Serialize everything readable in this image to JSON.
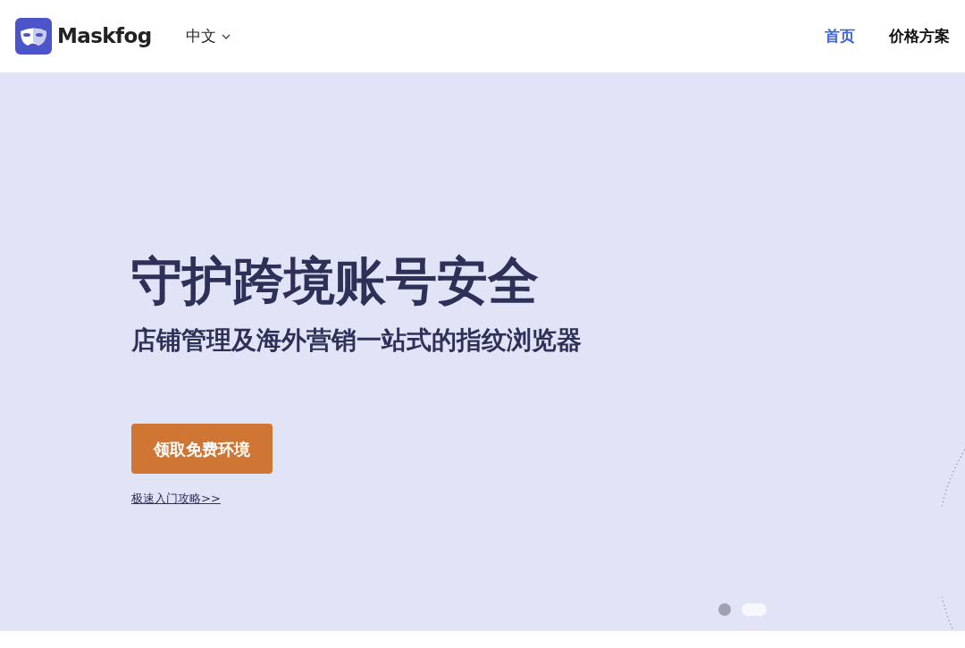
{
  "header": {
    "brand": "Maskfog",
    "language": "中文",
    "nav": [
      {
        "label": "首页",
        "selected": true
      },
      {
        "label": "价格方案",
        "selected": false
      }
    ]
  },
  "hero": {
    "title": "守护跨境账号安全",
    "subtitle": "店铺管理及海外营销一站式的指纹浏览器",
    "cta": "领取免费环境",
    "link": "极速入门攻略>>"
  },
  "carousel": [
    {
      "selected": false
    },
    {
      "selected": true
    }
  ]
}
